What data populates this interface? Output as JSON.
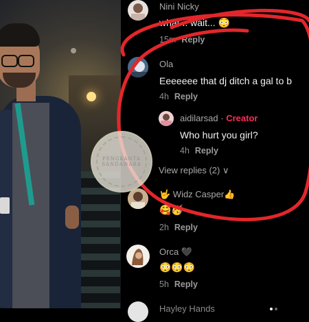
{
  "comments": [
    {
      "username": "Nini Nicky",
      "text": "what .. wait... 😳",
      "time": "15m",
      "reply": "Reply"
    },
    {
      "username": "Ola",
      "text": "Eeeeeee that dj ditch a gal to b",
      "time": "4h",
      "reply": "Reply"
    },
    {
      "username": "aidilarsad",
      "separator": " · ",
      "creator": "Creator",
      "text": "Who hurt you girl?",
      "time": "4h",
      "reply": "Reply"
    },
    {
      "username": "🤟 Widz Casper👍",
      "text": "🥰🥳",
      "time": "2h",
      "reply": "Reply"
    },
    {
      "username": "Orca 🖤",
      "text": "😳😳😳",
      "time": "5h",
      "reply": "Reply"
    },
    {
      "username": "Hayley Hands"
    }
  ],
  "view_replies": "View replies (2) ∨",
  "watermark": {
    "line1": "PENGKANTA",
    "line2": "SANDAWARA"
  },
  "colors": {
    "creator_red": "#fe2c55",
    "circle_red": "#e3262b"
  }
}
